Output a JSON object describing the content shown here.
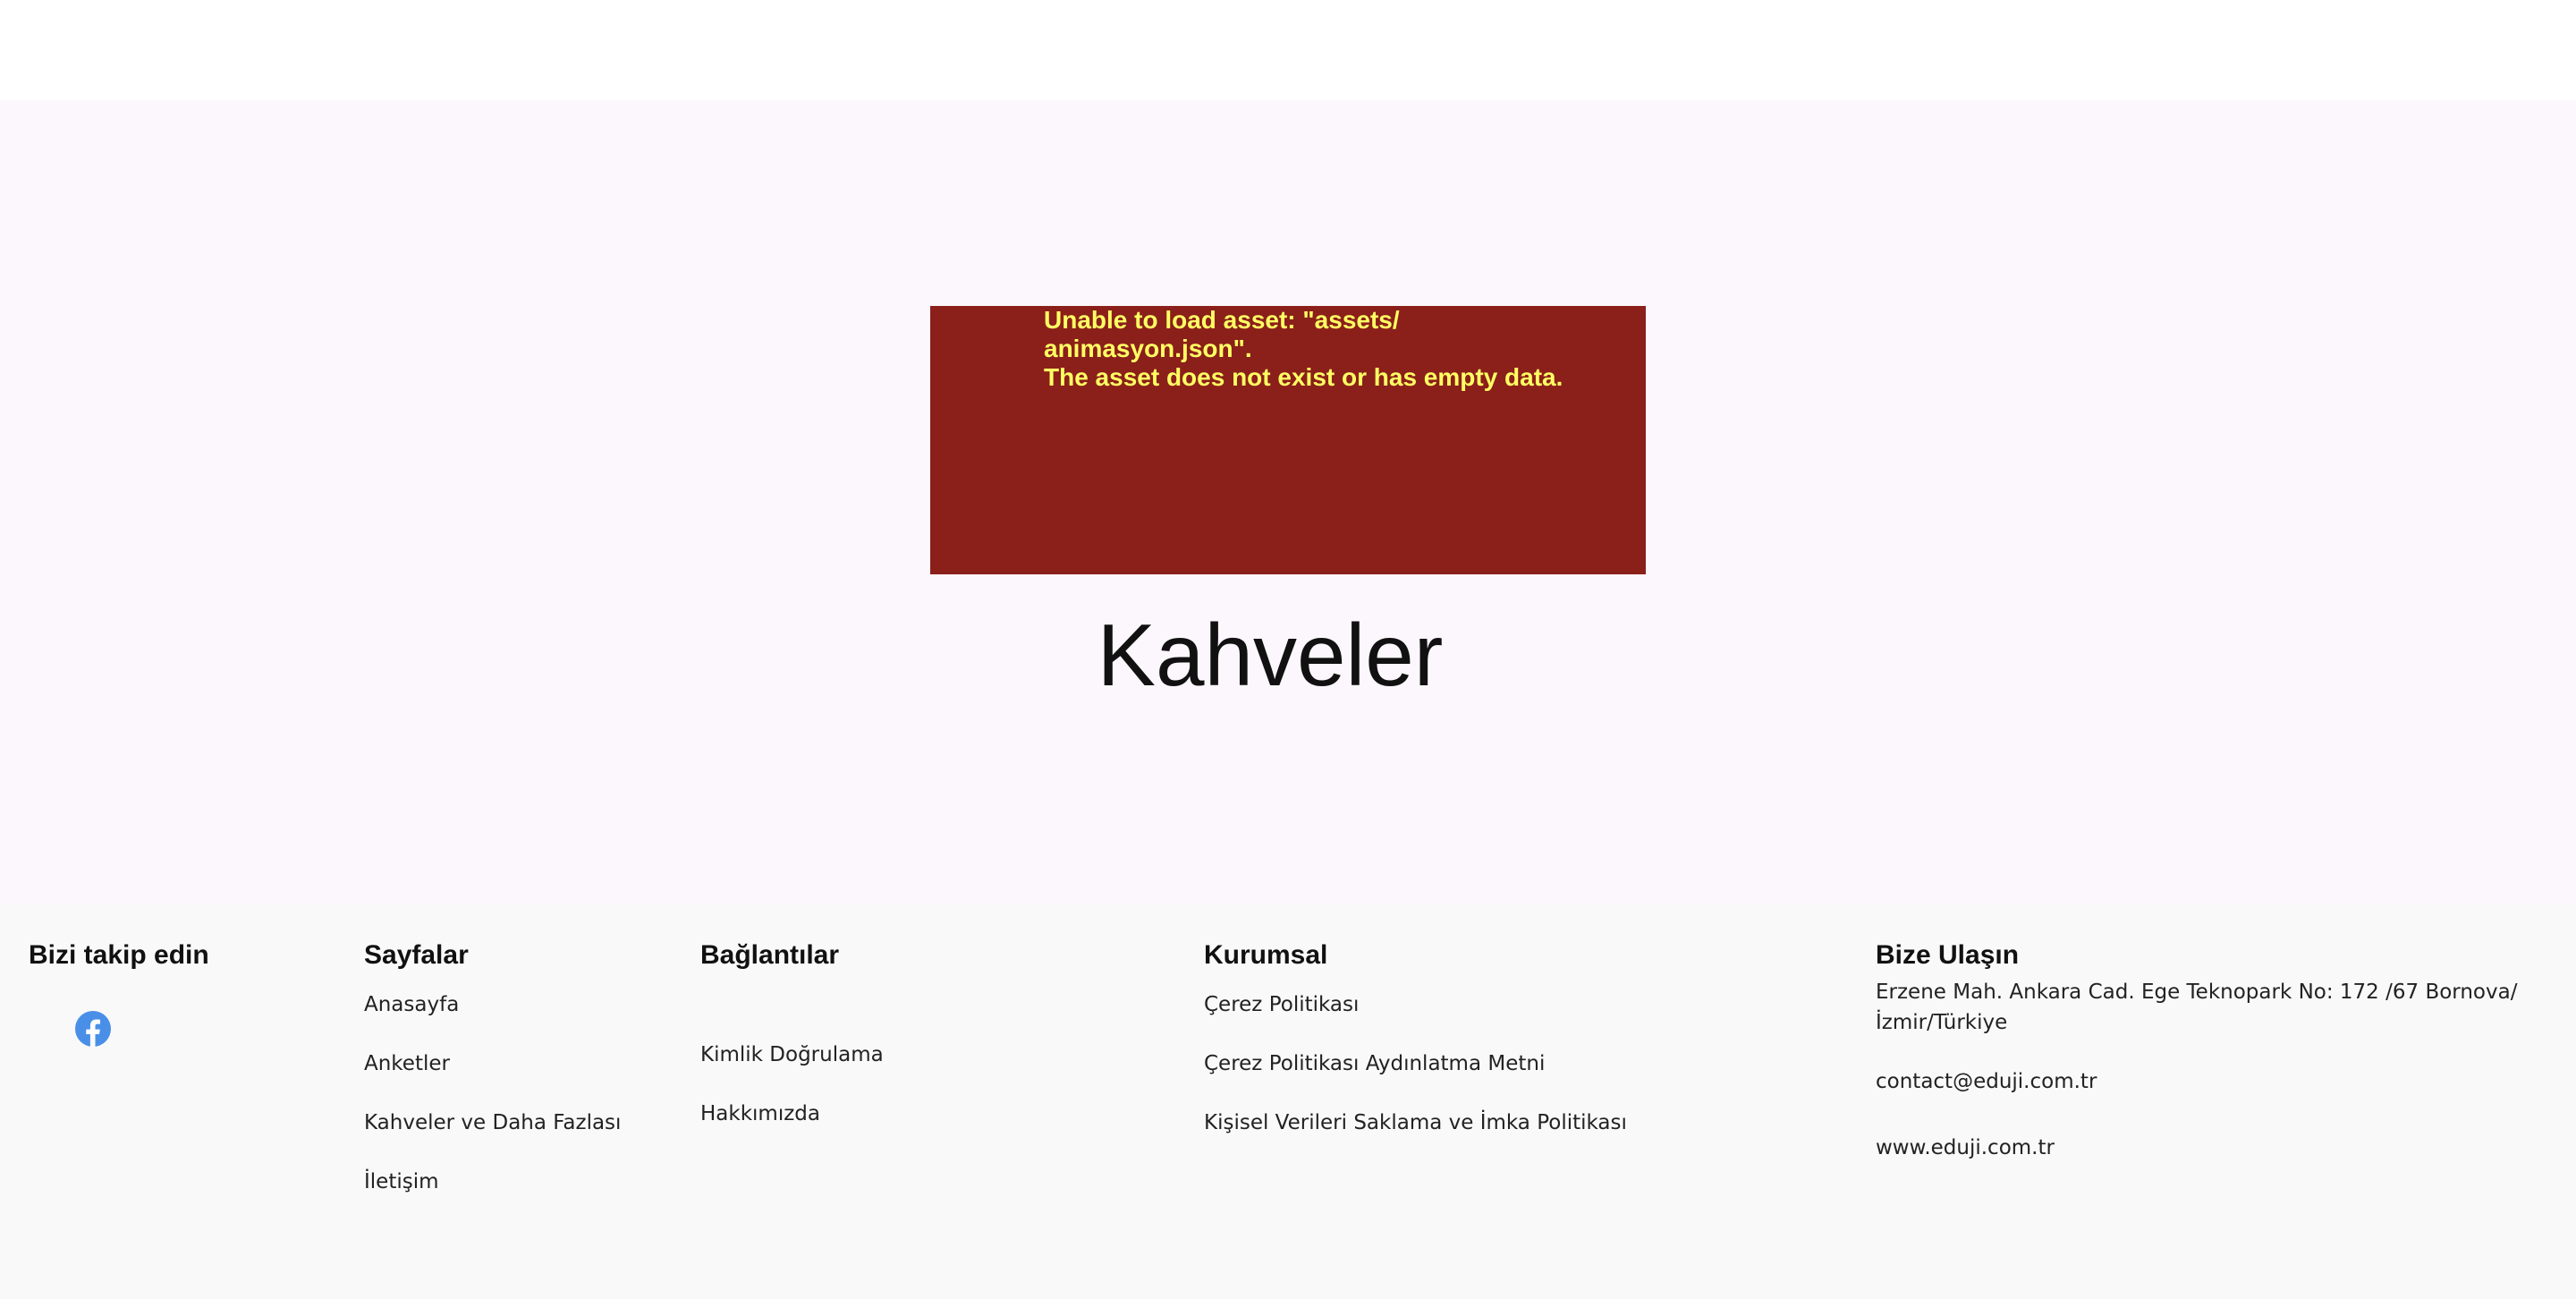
{
  "error": {
    "line1": "Unable to load asset: \"assets/",
    "line2": "animasyon.json\".",
    "line3": "The asset does not exist or has empty data."
  },
  "page_title": "Kahveler",
  "footer": {
    "follow": {
      "title": "Bizi takip edin",
      "icons": [
        "facebook-icon"
      ]
    },
    "pages": {
      "title": "Sayfalar",
      "items": [
        "Anasayfa",
        "Anketler",
        "Kahveler ve Daha Fazlası",
        "İletişim"
      ]
    },
    "links": {
      "title": "Bağlantılar",
      "items": [
        "Kimlik Doğrulama",
        "Hakkımızda"
      ]
    },
    "corporate": {
      "title": "Kurumsal",
      "items": [
        "Çerez Politikası",
        "Çerez Politikası Aydınlatma Metni",
        "Kişisel Verileri Saklama ve İmka Politikası"
      ]
    },
    "contact": {
      "title": "Bize Ulaşın",
      "address": "Erzene Mah. Ankara Cad. Ege Teknopark No: 172 /67 Bornova/ İzmir/Türkiye",
      "email": "contact@eduji.com.tr",
      "website": "www.eduji.com.tr"
    }
  },
  "colors": {
    "error_bg": "#8b1f1a",
    "error_text": "#ffff63",
    "hero_bg": "#fcf7fc",
    "footer_bg": "#f9f9f9",
    "facebook": "#4a8fe7"
  }
}
